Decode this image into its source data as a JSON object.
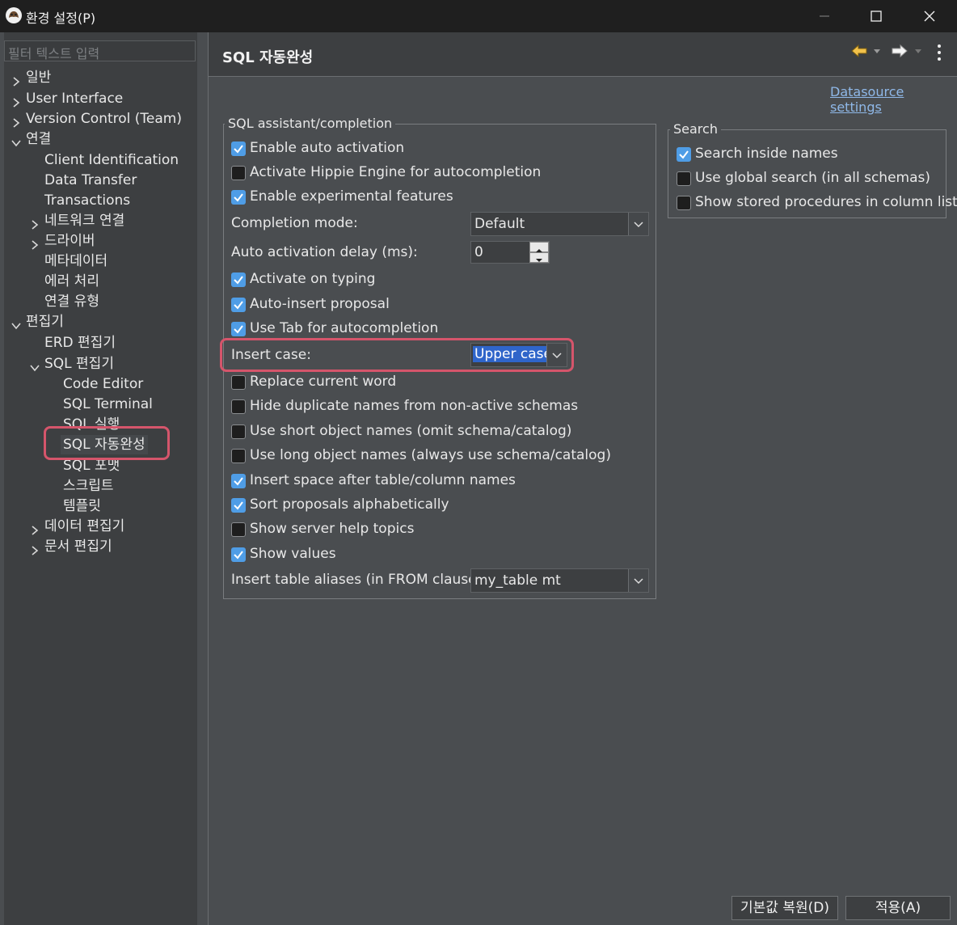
{
  "window": {
    "title": "환경 설정(P)",
    "controls": [
      "minimize-icon",
      "maximize-icon",
      "close-icon"
    ]
  },
  "sidebar": {
    "filter_placeholder": "필터 텍스트 입력",
    "items": [
      {
        "label": "일반",
        "depth": 0,
        "expander": "collapsed"
      },
      {
        "label": "User Interface",
        "depth": 0,
        "expander": "collapsed"
      },
      {
        "label": "Version Control (Team)",
        "depth": 0,
        "expander": "collapsed"
      },
      {
        "label": "연결",
        "depth": 0,
        "expander": "expanded"
      },
      {
        "label": "Client Identification",
        "depth": 1,
        "expander": "none"
      },
      {
        "label": "Data Transfer",
        "depth": 1,
        "expander": "none"
      },
      {
        "label": "Transactions",
        "depth": 1,
        "expander": "none"
      },
      {
        "label": "네트워크 연결",
        "depth": 1,
        "expander": "collapsed"
      },
      {
        "label": "드라이버",
        "depth": 1,
        "expander": "collapsed"
      },
      {
        "label": "메타데이터",
        "depth": 1,
        "expander": "none"
      },
      {
        "label": "에러 처리",
        "depth": 1,
        "expander": "none"
      },
      {
        "label": "연결 유형",
        "depth": 1,
        "expander": "none"
      },
      {
        "label": "편집기",
        "depth": 0,
        "expander": "expanded"
      },
      {
        "label": "ERD 편집기",
        "depth": 1,
        "expander": "none"
      },
      {
        "label": "SQL 편집기",
        "depth": 1,
        "expander": "expanded"
      },
      {
        "label": "Code Editor",
        "depth": 2,
        "expander": "none"
      },
      {
        "label": "SQL Terminal",
        "depth": 2,
        "expander": "none"
      },
      {
        "label": "SQL 실행",
        "depth": 2,
        "expander": "none"
      },
      {
        "label": "SQL 자동완성",
        "depth": 2,
        "expander": "none",
        "selected": true
      },
      {
        "label": "SQL 포맷",
        "depth": 2,
        "expander": "none"
      },
      {
        "label": "스크립트",
        "depth": 2,
        "expander": "none"
      },
      {
        "label": "템플릿",
        "depth": 2,
        "expander": "none"
      },
      {
        "label": "데이터 편집기",
        "depth": 1,
        "expander": "collapsed"
      },
      {
        "label": "문서 편집기",
        "depth": 1,
        "expander": "collapsed"
      }
    ]
  },
  "page": {
    "title": "SQL 자동완성",
    "datasource_link": "Datasource settings",
    "nav_icons": [
      "back-arrow-icon",
      "back-dropdown-icon",
      "forward-arrow-icon",
      "forward-dropdown-icon",
      "more-menu-icon"
    ]
  },
  "assistant": {
    "legend": "SQL assistant/completion",
    "enable_auto_activation": {
      "label": "Enable auto activation",
      "checked": true
    },
    "hippie": {
      "label": "Activate Hippie Engine for autocompletion",
      "checked": false
    },
    "experimental": {
      "label": "Enable experimental features",
      "checked": true
    },
    "completion_mode": {
      "label": "Completion mode:",
      "value": "Default"
    },
    "delay": {
      "label": "Auto activation delay (ms):",
      "value": "0"
    },
    "activate_typing": {
      "label": "Activate on typing",
      "checked": true
    },
    "auto_insert": {
      "label": "Auto-insert proposal",
      "checked": true
    },
    "use_tab": {
      "label": "Use Tab for autocompletion",
      "checked": true
    },
    "insert_case": {
      "label": "Insert case:",
      "value": "Upper case"
    },
    "replace_word": {
      "label": "Replace current word",
      "checked": false
    },
    "hide_duplicates": {
      "label": "Hide duplicate names from non-active schemas",
      "checked": false
    },
    "short_names": {
      "label": "Use short object names (omit schema/catalog)",
      "checked": false
    },
    "long_names": {
      "label": "Use long object names (always use schema/catalog)",
      "checked": false
    },
    "insert_space": {
      "label": "Insert space after table/column names",
      "checked": true
    },
    "sort_alpha": {
      "label": "Sort proposals alphabetically",
      "checked": true
    },
    "server_help": {
      "label": "Show server help topics",
      "checked": false
    },
    "show_values": {
      "label": "Show values",
      "checked": true
    },
    "table_aliases": {
      "label": "Insert table aliases (in FROM clause):",
      "value": "my_table mt"
    }
  },
  "search": {
    "legend": "Search",
    "inside_names": {
      "label": "Search inside names",
      "checked": true
    },
    "global_search": {
      "label": "Use global search (in all schemas)",
      "checked": false
    },
    "stored_procs": {
      "label": "Show stored procedures in column list",
      "checked": false
    }
  },
  "buttons": {
    "restore_defaults": "기본값 복원(D)",
    "apply": "적용(A)"
  },
  "colors": {
    "accent": "#4f9de6",
    "highlight_box": "#d5556b",
    "background": "#4a4d50",
    "link": "#8fb8e8"
  }
}
